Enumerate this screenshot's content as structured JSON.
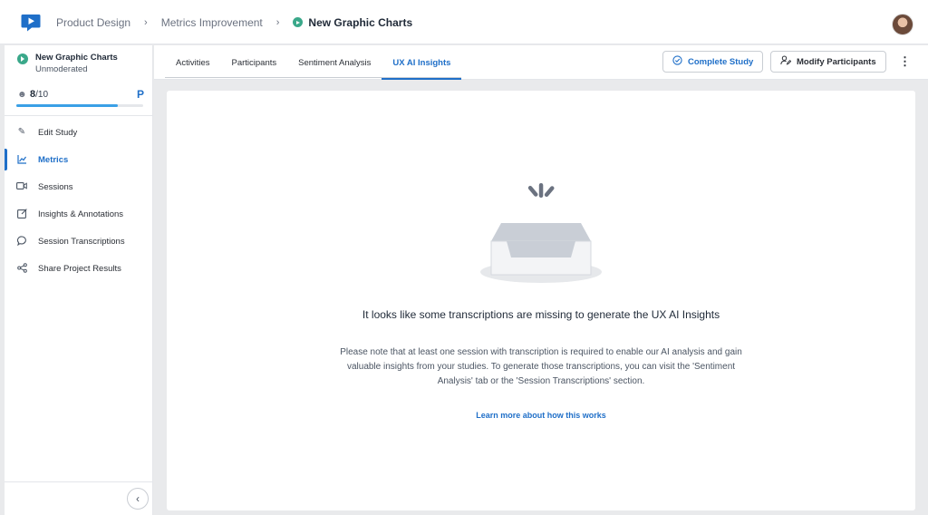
{
  "breadcrumbs": {
    "items": [
      "Product Design",
      "Metrics Improvement"
    ],
    "current": "New Graphic Charts"
  },
  "sidebar": {
    "study_title": "New Graphic Charts",
    "study_type": "Unmoderated",
    "participants": {
      "current": "8",
      "total": "/10",
      "progress_fraction": 0.8,
      "badge": "P"
    },
    "nav": [
      {
        "label": "Edit Study",
        "icon": "pencil-icon",
        "active": false
      },
      {
        "label": "Metrics",
        "icon": "chart-icon",
        "active": true
      },
      {
        "label": "Sessions",
        "icon": "video-icon",
        "active": false
      },
      {
        "label": "Insights & Annotations",
        "icon": "note-icon",
        "active": false
      },
      {
        "label": "Session Transcriptions",
        "icon": "chat-bubble-icon",
        "active": false
      },
      {
        "label": "Share Project Results",
        "icon": "share-icon",
        "active": false
      }
    ]
  },
  "tabs": [
    {
      "label": "Activities",
      "active": false
    },
    {
      "label": "Participants",
      "active": false
    },
    {
      "label": "Sentiment Analysis",
      "active": false
    },
    {
      "label": "UX AI Insights",
      "active": true
    }
  ],
  "toolbar": {
    "complete_label": "Complete Study",
    "modify_label": "Modify Participants"
  },
  "empty_state": {
    "title": "It looks like some transcriptions are missing to generate the UX AI Insights",
    "description": "Please note that at least one session with transcription is required to enable our AI analysis and gain valuable insights from your studies. To generate those transcriptions, you can visit the 'Sentiment Analysis' tab or the 'Session Transcriptions' section.",
    "link": "Learn more about how this works"
  },
  "colors": {
    "accent": "#1f6fc8",
    "status": "#3aa88a",
    "progress": "#3aa0e6"
  }
}
